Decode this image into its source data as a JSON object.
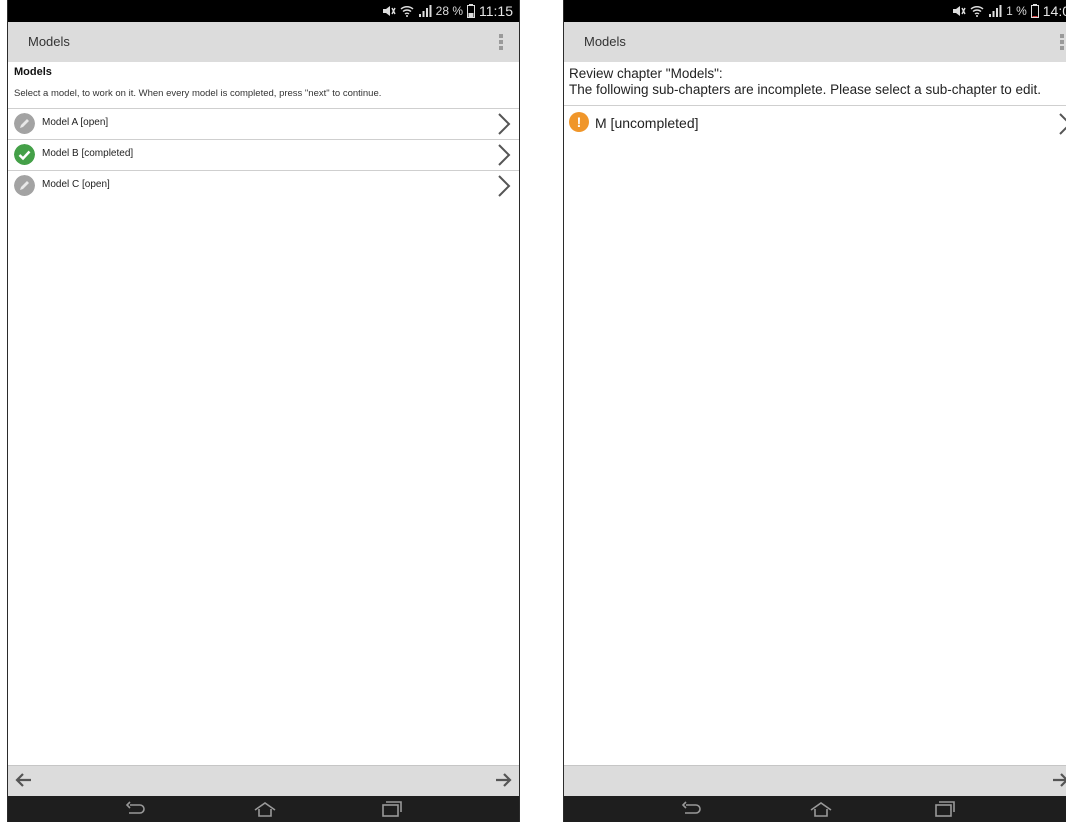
{
  "left": {
    "status": {
      "battery_pct": "28 %",
      "time": "11:15"
    },
    "app_title": "Models",
    "heading": "Models",
    "description": "Select a model, to work on it. When every model is completed, press \"next\" to continue.",
    "items": [
      {
        "label": "Model A [open]",
        "state": "open"
      },
      {
        "label": "Model B [completed]",
        "state": "completed"
      },
      {
        "label": "Model C [open]",
        "state": "open"
      }
    ]
  },
  "right": {
    "status": {
      "battery_pct": "1 %",
      "time": "14:0"
    },
    "app_title": "Models",
    "review_line1": "Review chapter \"Models\":",
    "review_line2": "The following sub-chapters are incomplete. Please select a sub-chapter to edit.",
    "items": [
      {
        "label": "M [uncompleted]",
        "icon_text": "!"
      }
    ]
  },
  "colors": {
    "open": "#a3a3a3",
    "completed": "#44a048",
    "warning": "#f0962a",
    "bar": "#dcdcdc"
  },
  "icons": [
    "pencil-icon",
    "checkmark-icon",
    "exclamation-icon",
    "chevron-right-icon",
    "back-arrow-icon",
    "next-arrow-icon",
    "nav-back-icon",
    "nav-home-icon",
    "nav-recents-icon"
  ]
}
